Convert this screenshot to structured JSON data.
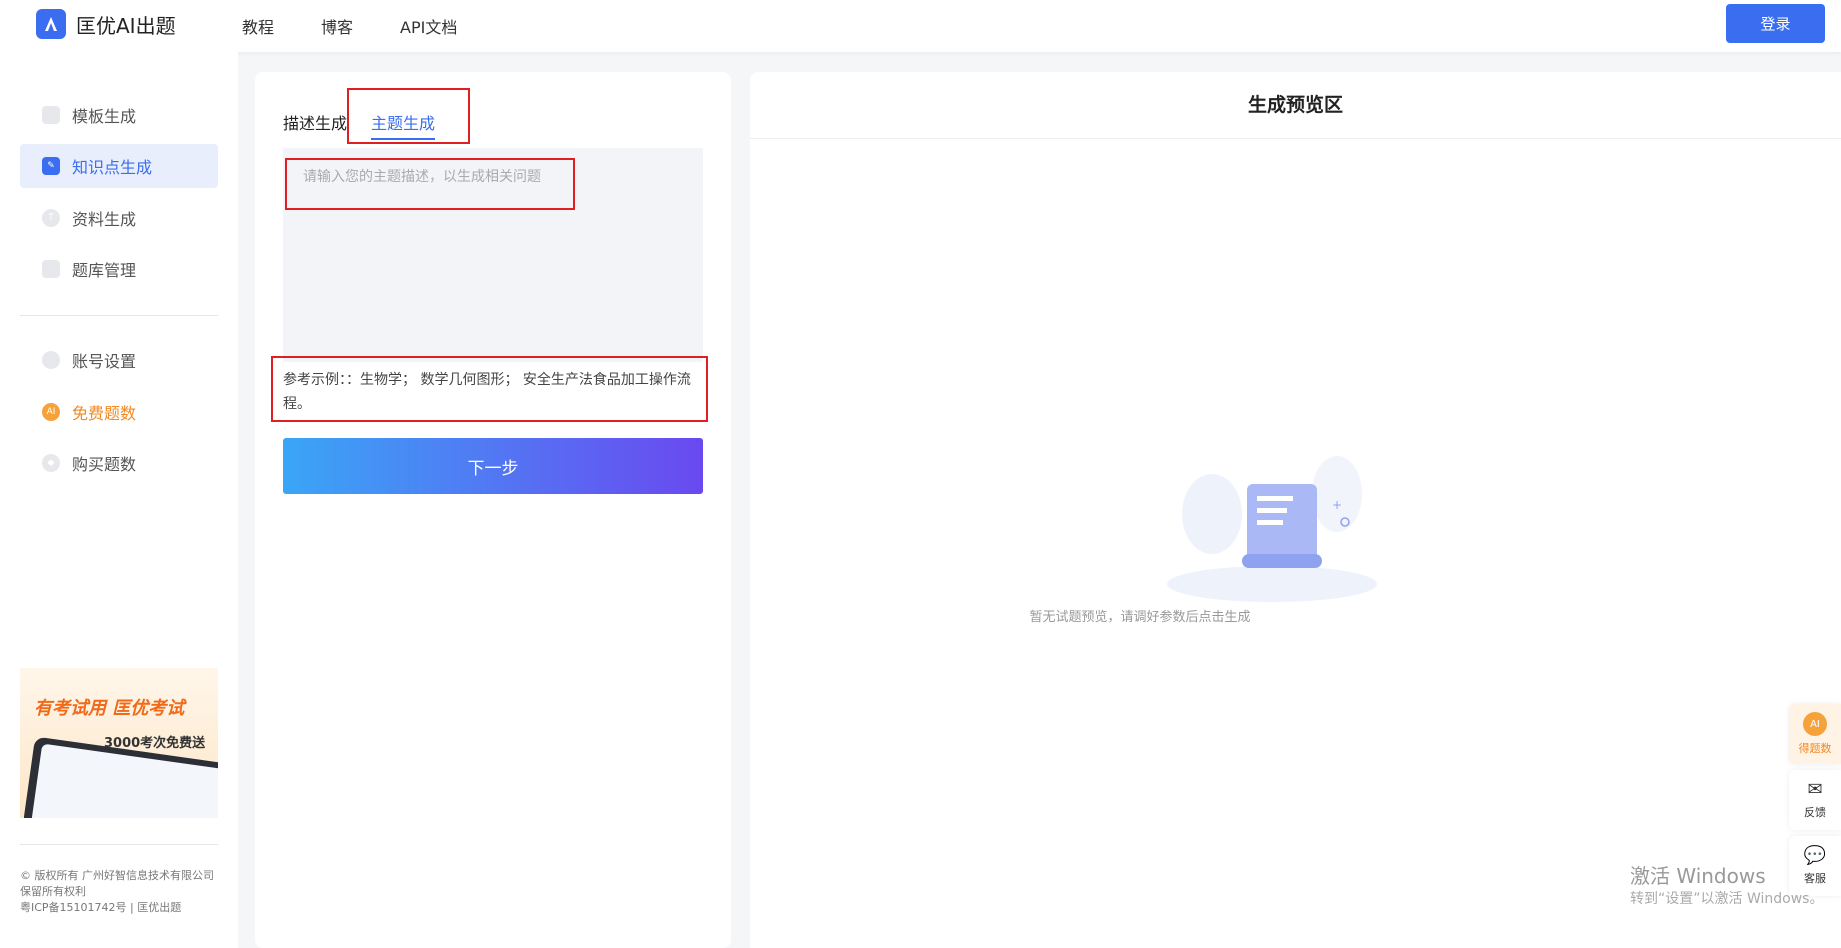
{
  "header": {
    "brand_name": "匡优AI出题",
    "nav": [
      "教程",
      "博客",
      "API文档"
    ],
    "login_label": "登录"
  },
  "sidebar": {
    "items": [
      {
        "label": "模板生成"
      },
      {
        "label": "知识点生成"
      },
      {
        "label": "资料生成"
      },
      {
        "label": "题库管理"
      },
      {
        "label": "账号设置"
      },
      {
        "label": "免费题数"
      },
      {
        "label": "购买题数"
      }
    ],
    "promo": {
      "title": "有考试用 匡优考试",
      "subtitle": "3000考次免费送"
    },
    "footer": [
      "© 版权所有 广州好智信息技术有限公司",
      "保留所有权利",
      "粤ICP备15101742号 | 匡优出题"
    ]
  },
  "form": {
    "tabs": [
      "描述生成",
      "主题生成"
    ],
    "input_placeholder": "请输入您的主题描述，以生成相关问题",
    "example_text": "参考示例：：生物学； 数学几何图形； 安全生产法食品加工操作流程。",
    "next_label": "下一步"
  },
  "preview": {
    "title": "生成预览区",
    "empty_text": "暂无试题预览，请调好参数后点击生成"
  },
  "floaters": [
    {
      "label": "得题数",
      "badge": "AI"
    },
    {
      "label": "反馈"
    },
    {
      "label": "客服"
    }
  ],
  "watermark": {
    "line1": "激活 Windows",
    "line2": "转到“设置”以激活 Windows。"
  },
  "colors": {
    "accent": "#3a6df0",
    "orange": "#f08a24",
    "highlight": "#e02020"
  }
}
